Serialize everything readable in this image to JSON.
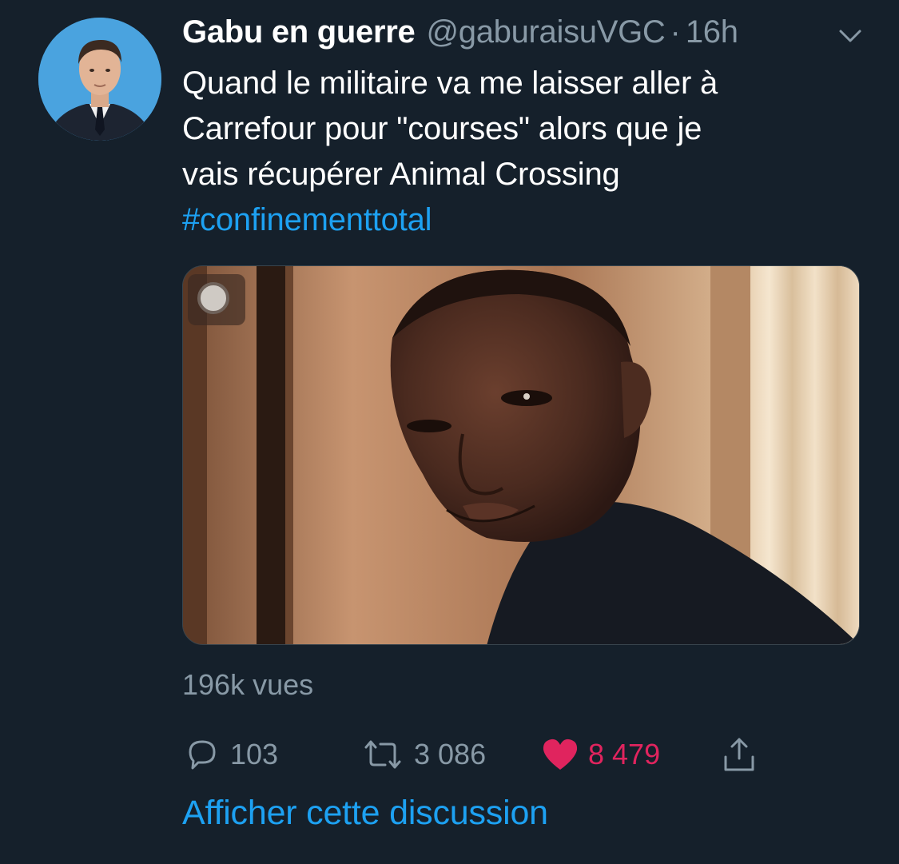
{
  "tweet": {
    "display_name": "Gabu en guerre",
    "handle": "@gaburaisuVGC",
    "separator": "·",
    "time": "16h",
    "text_lines": [
      "Quand le militaire va me laisser aller à",
      "Carrefour pour \"courses\" alors que je",
      "vais récupérer Animal Crossing"
    ],
    "hashtag": "#confinementtotal",
    "views": "196k vues"
  },
  "actions": {
    "replies": "103",
    "retweets": "3 086",
    "likes": "8 479"
  },
  "footer": {
    "show_thread": "Afficher cette discussion"
  },
  "colors": {
    "background": "#15202b",
    "primary_text": "#ffffff",
    "secondary_text": "#8899a6",
    "link": "#1da1f2",
    "like": "#e0245e"
  },
  "icons": {
    "menu": "chevron-down-icon",
    "reply": "reply-bubble-icon",
    "retweet": "retweet-icon",
    "like": "heart-icon",
    "share": "share-icon",
    "gif": "gif-indicator-icon"
  }
}
